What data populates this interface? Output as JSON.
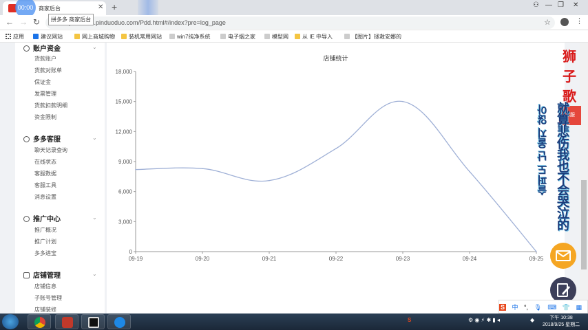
{
  "browser": {
    "recording_badge": "00:00",
    "tab_title": "商家后台",
    "tooltip": "拼多多 商家后台",
    "new_tab": "+",
    "url": "https://mms.pinduoduo.com/Pdd.html#/index?pre=log_page"
  },
  "bookmarks": [
    {
      "label": "应用",
      "icon": "apps-grid-icon"
    },
    {
      "label": "建议网站",
      "icon": "bing-icon"
    },
    {
      "label": "网上商城购物",
      "icon": "folder-icon"
    },
    {
      "label": "装机常用网站",
      "icon": "folder-icon"
    },
    {
      "label": "win7纯净系统",
      "icon": "page-icon"
    },
    {
      "label": "电子烟之家",
      "icon": "page-icon"
    },
    {
      "label": "模型网",
      "icon": "page-icon"
    },
    {
      "label": "从 IE 中导入",
      "icon": "folder-icon"
    },
    {
      "label": "【图片】拯救安娜的",
      "icon": "page-icon"
    }
  ],
  "sidebar": {
    "sections": [
      {
        "title": "账户资金",
        "items": [
          "货款账户",
          "货款对账单",
          "保证金",
          "发票管理",
          "货款扣款明细",
          "资金限制"
        ]
      },
      {
        "title": "多多客服",
        "items": [
          "聊天记录查询",
          "在线状态",
          "客服数据",
          "客服工具",
          "消息设置"
        ]
      },
      {
        "title": "推广中心",
        "items": [
          "推广概况",
          "推广计划",
          "多多进宝"
        ]
      },
      {
        "title": "店铺管理",
        "items": [
          "店铺信息",
          "子账号管理",
          "店铺装修"
        ]
      }
    ]
  },
  "overlay": {
    "watermark": "狮子歌歌",
    "side_tab": "客服",
    "vertical_text_1": "就算悲伤我也不会哭泣的",
    "vertical_text_2": "슬퍼도 난 울지 않아"
  },
  "ime": {
    "logo": "S",
    "mode": "中",
    "symbols": "°,"
  },
  "taskbar": {
    "clock_time": "下午 10:38",
    "clock_date": "2018/9/25 星期二"
  },
  "chart_data": {
    "type": "line",
    "title": "店铺统计",
    "x": [
      "09-19",
      "09-20",
      "09-21",
      "09-22",
      "09-23",
      "09-24",
      "09-25"
    ],
    "series": [
      {
        "values": [
          8200,
          8300,
          7100,
          10300,
          15000,
          8000,
          0
        ]
      }
    ],
    "y_ticks": [
      "0",
      "3,000",
      "6,000",
      "9,000",
      "12,000",
      "15,000",
      "18,000"
    ],
    "ylim": [
      0,
      18000
    ],
    "grid": false,
    "color": "#9fb0d6"
  }
}
